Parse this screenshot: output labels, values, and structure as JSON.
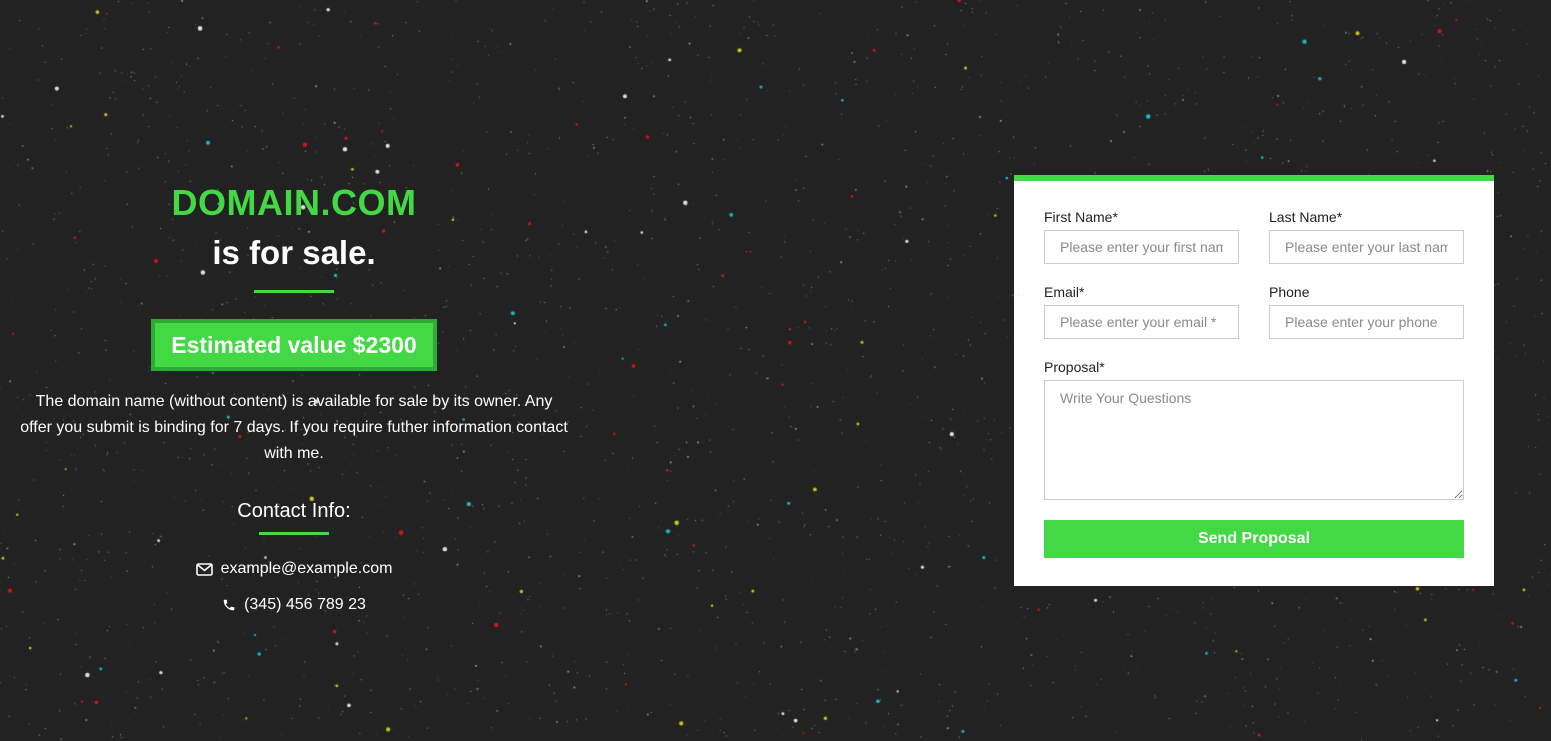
{
  "colors": {
    "background": "#222222",
    "accent": "#43d944",
    "accent_dark": "#2eab35",
    "card": "#ffffff",
    "text_light": "#ffffff",
    "text_dark": "#222222"
  },
  "hero": {
    "domain": "DOMAIN.COM",
    "tagline": "is for sale.",
    "estimate": "Estimated value $2300",
    "description": "The domain name (without content) is available for sale by its owner. Any offer you submit is binding for 7 days. If you require futher information contact with me."
  },
  "contact": {
    "title": "Contact Info:",
    "email": "example@example.com",
    "email_icon": "envelope-icon",
    "phone": "(345) 456 789 23",
    "phone_icon": "phone-icon"
  },
  "form": {
    "first_name": {
      "label": "First Name*",
      "placeholder": "Please enter your first name *",
      "value": ""
    },
    "last_name": {
      "label": "Last Name*",
      "placeholder": "Please enter your last name *",
      "value": ""
    },
    "email": {
      "label": "Email*",
      "placeholder": "Please enter your email *",
      "value": ""
    },
    "phone": {
      "label": "Phone",
      "placeholder": "Please enter your phone",
      "value": ""
    },
    "proposal": {
      "label": "Proposal*",
      "placeholder": "Write Your Questions",
      "value": ""
    },
    "submit_label": "Send Proposal"
  }
}
